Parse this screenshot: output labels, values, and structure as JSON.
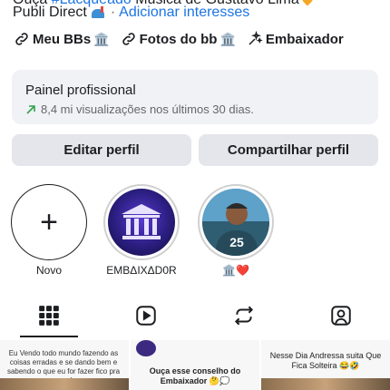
{
  "bio": {
    "line1_prefix": "Ouça ",
    "line1_link": "#Lacqueado",
    "line1_rest": " Música de Gusttavo Lima",
    "line2_text": "Publi Direct",
    "line2_link": "Adicionar interesses"
  },
  "links": [
    {
      "label": "Meu BBs",
      "icon": "link-icon"
    },
    {
      "label": "Fotos do bb",
      "icon": "link-icon"
    },
    {
      "label": "Embaixador",
      "icon": "sparkle-icon"
    }
  ],
  "panel": {
    "title": "Painel profissional",
    "stat": "8,4 mi visualizações nos últimos 30 dias."
  },
  "buttons": {
    "edit": "Editar perfil",
    "share": "Compartilhar perfil"
  },
  "highlights": [
    {
      "label": "Novo"
    },
    {
      "label": "EMBΔIXΔD0R"
    },
    {
      "label": "🏛️❤️"
    }
  ],
  "tabs": [
    "grid-icon",
    "reels-icon",
    "reposts-icon",
    "tagged-icon"
  ],
  "posts": [
    {
      "text": "Eu Vendo todo mundo fazendo as coisas erradas e se dando bem e sabendo o que eu for fazer fico pra exemplo:"
    },
    {
      "text": "Ouça esse conselho do Embaixador 🤔💭"
    },
    {
      "text": "Nesse Dia Andressa suita Que Fica Solteira 😂🤣"
    }
  ],
  "colors": {
    "link": "#1b74e4",
    "muted": "#65676b",
    "surface": "#f0f2f5",
    "button": "#e4e6eb",
    "up_arrow": "#31a24c"
  }
}
